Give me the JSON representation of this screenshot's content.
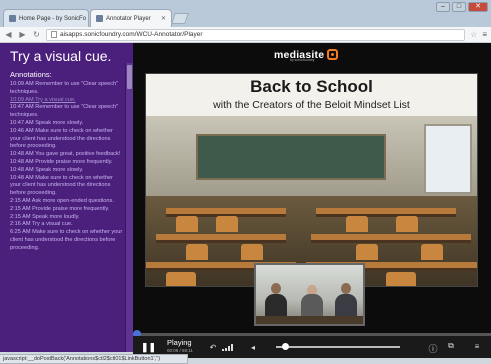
{
  "browser": {
    "tabs": [
      {
        "title": "Home Page - by SonicFo"
      },
      {
        "title": "Annotator Player"
      }
    ],
    "url": "aisapps.sonicfoundry.com/WCU-Annotator/Player",
    "window_buttons": [
      "–",
      "□",
      "✕"
    ]
  },
  "sidebar": {
    "slide_title": "Try a visual cue.",
    "annotations_label": "Annotations:",
    "annotations": [
      {
        "text": "10:09 AM Remember to use \"Clear speech\" techniques.",
        "selected": false
      },
      {
        "text": "10:09 AM Try a visual cue.",
        "selected": true
      },
      {
        "text": "10:47 AM Remember to use \"Clear speech\" techniques.",
        "selected": false
      },
      {
        "text": "10:47 AM Speak more slowly.",
        "selected": false
      },
      {
        "text": "10:46 AM Make sure to check on whether your client has understood the directions before proceeding.",
        "selected": false
      },
      {
        "text": "10:48 AM You gave great, positive feedback!",
        "selected": false
      },
      {
        "text": "10:48 AM Provide praise more frequently.",
        "selected": false
      },
      {
        "text": "10:48 AM Speak more slowly.",
        "selected": false
      },
      {
        "text": "10:48 AM Make sure to check on whether your client has understood the directions before proceeding.",
        "selected": false
      },
      {
        "text": "2:15 AM Ask more open-ended questions.",
        "selected": false
      },
      {
        "text": "2:15 AM Provide praise more frequently.",
        "selected": false
      },
      {
        "text": "2:15 AM Speak more loudly.",
        "selected": false
      },
      {
        "text": "2:16 AM Try a visual cue.",
        "selected": false
      },
      {
        "text": "6:25 AM Make sure to check on whether your client has understood the directions before proceeding.",
        "selected": false
      }
    ]
  },
  "player": {
    "logo_text": "mediasite",
    "logo_sub": "by sonicfoundry",
    "slide": {
      "heading": "Back to School",
      "subheading": "with the Creators of the Beloit Mindset List"
    },
    "controls": {
      "pause_icon": "pause-icon",
      "state": "Playing",
      "time": "00:09 / 59:11",
      "volume_fraction": 0.05
    }
  },
  "status_bar": "javascript:__doPostBack('Annotations$ctl2$ctl01$LinkButton1','')"
}
